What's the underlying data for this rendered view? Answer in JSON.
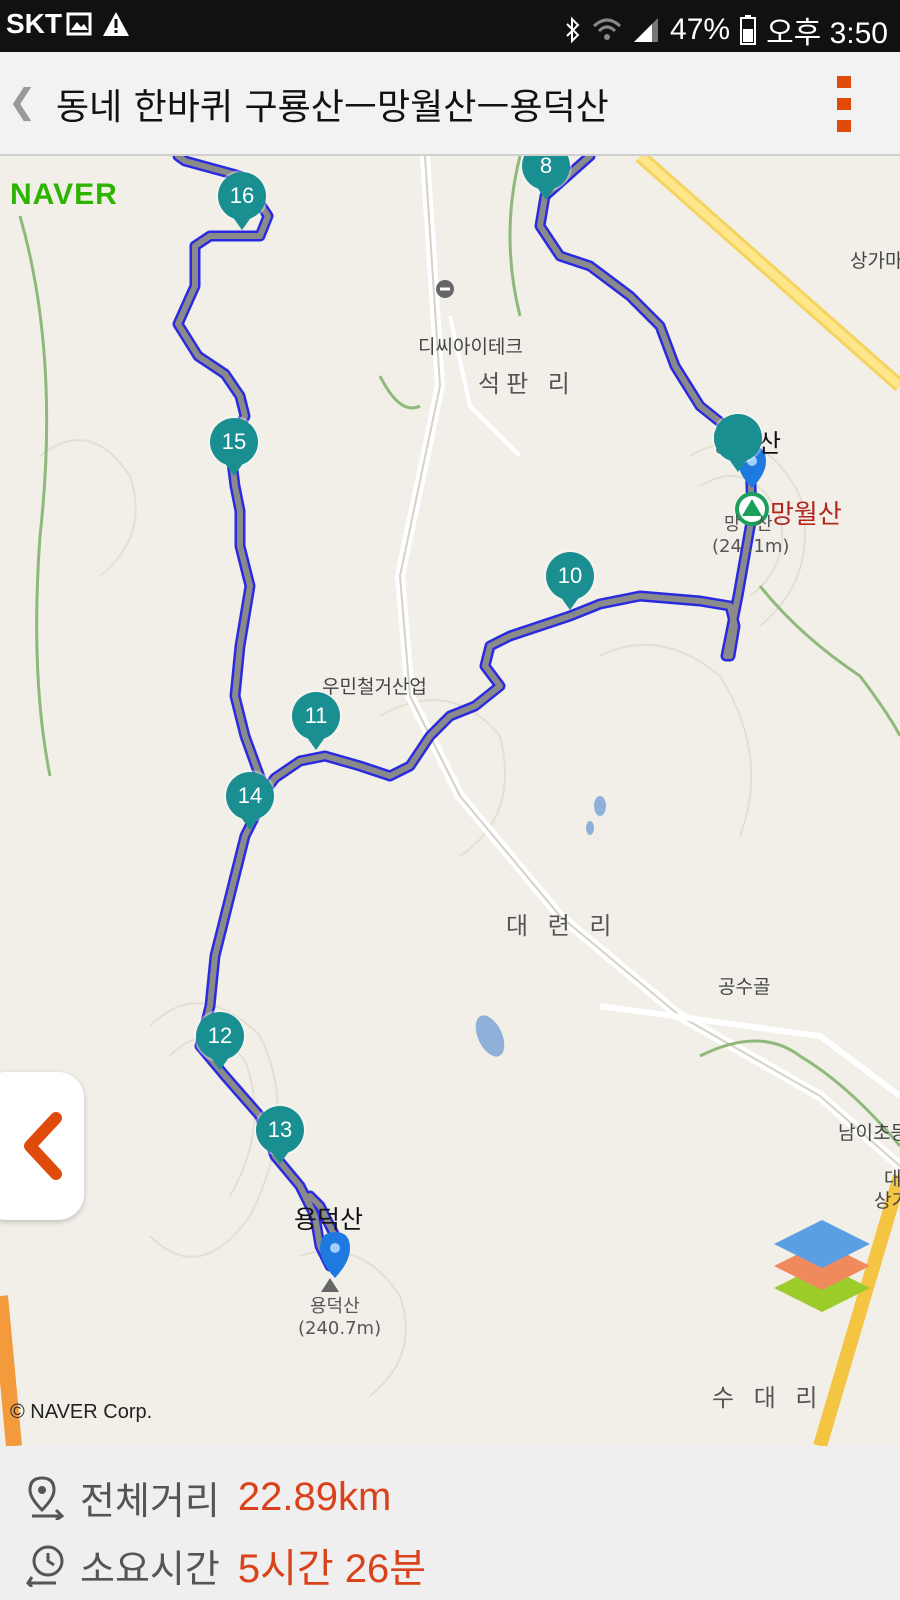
{
  "status_bar": {
    "carrier": "SKT",
    "battery": "47%",
    "time": "오후 3:50"
  },
  "header": {
    "title": "동네 한바퀴 구룡산ㅡ망월산ㅡ용덕산",
    "back_icon": "back-chevron-icon",
    "menu_icon": "more-vertical-icon"
  },
  "map": {
    "provider_logo": "NAVER",
    "copyright": "© NAVER Corp.",
    "places": {
      "disiaitek": "디씨아이테크",
      "seokpan": "석판 리",
      "umin": "우민철거산업",
      "daeryeon": "대 련 리",
      "gongsugol": "공수골",
      "sangga": "상가마",
      "namicho": "남이초등",
      "sudae": "수 대 리",
      "dae_edge": "대",
      "sang_edge": "상기"
    },
    "peaks": {
      "mangwol_label": "망월산",
      "mangwol_red": "망월산",
      "mangwol_sub": "망",
      "mangwol_sub2": "산",
      "mangwol_elev": "(24 .1m)",
      "yongdeok_label": "용덕산",
      "yongdeok_name": "용덕산",
      "yongdeok_elev": "(240.7m)"
    },
    "waypoints": [
      "8",
      "16",
      "15",
      "10",
      "11",
      "14",
      "12",
      "13"
    ],
    "route_color": "#2a2ae0",
    "waypoint_color": "#1a8f91"
  },
  "summary": {
    "distance_label": "전체거리",
    "distance_value": "22.89km",
    "time_label": "소요시간",
    "time_value": "5시간 26분"
  }
}
